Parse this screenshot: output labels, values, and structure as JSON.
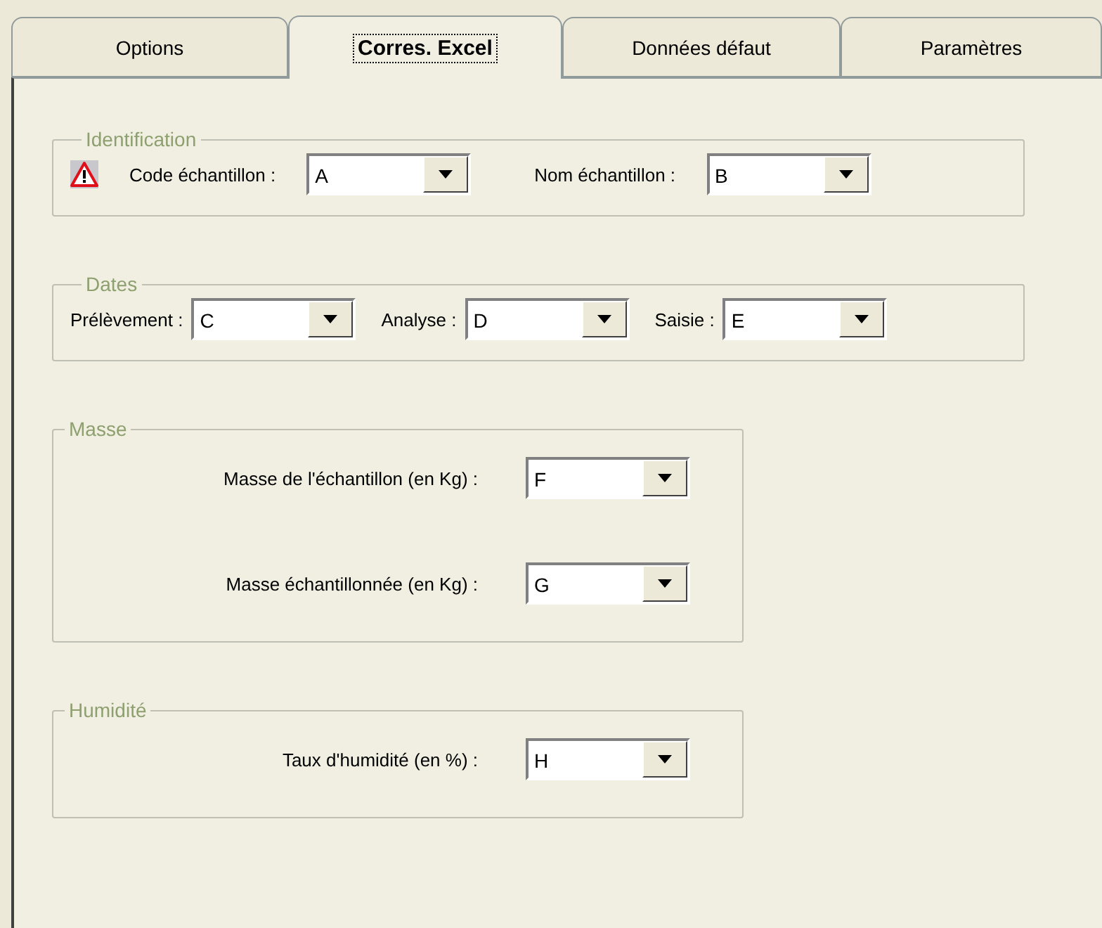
{
  "tabs": [
    {
      "label": "Options",
      "selected": false
    },
    {
      "label": "Corres. Excel",
      "selected": true
    },
    {
      "label": "Données défaut",
      "selected": false
    },
    {
      "label": "Paramètres",
      "selected": false
    }
  ],
  "groups": [
    {
      "legend": "Identification",
      "kind": "wide-row",
      "fields": [
        {
          "label": "Code échantillon :",
          "value": "A",
          "warning": true
        },
        {
          "label": "Nom échantillon :",
          "value": "B",
          "warning": false
        }
      ]
    },
    {
      "legend": "Dates",
      "kind": "compact-row",
      "fields": [
        {
          "label": "Prélèvement :",
          "value": "C",
          "warning": false
        },
        {
          "label": "Analyse :",
          "value": "D",
          "warning": false
        },
        {
          "label": "Saisie :",
          "value": "E",
          "warning": false
        }
      ]
    },
    {
      "legend": "Masse",
      "kind": "stack",
      "fields": [
        {
          "label": "Masse de l'échantillon (en Kg) :",
          "value": "F",
          "warning": false
        },
        {
          "label": "Masse échantillonnée (en Kg) :",
          "value": "G",
          "warning": false
        }
      ]
    },
    {
      "legend": "Humidité",
      "kind": "stack",
      "fields": [
        {
          "label": "Taux d'humidité (en %) :",
          "value": "H",
          "warning": false
        }
      ]
    }
  ]
}
